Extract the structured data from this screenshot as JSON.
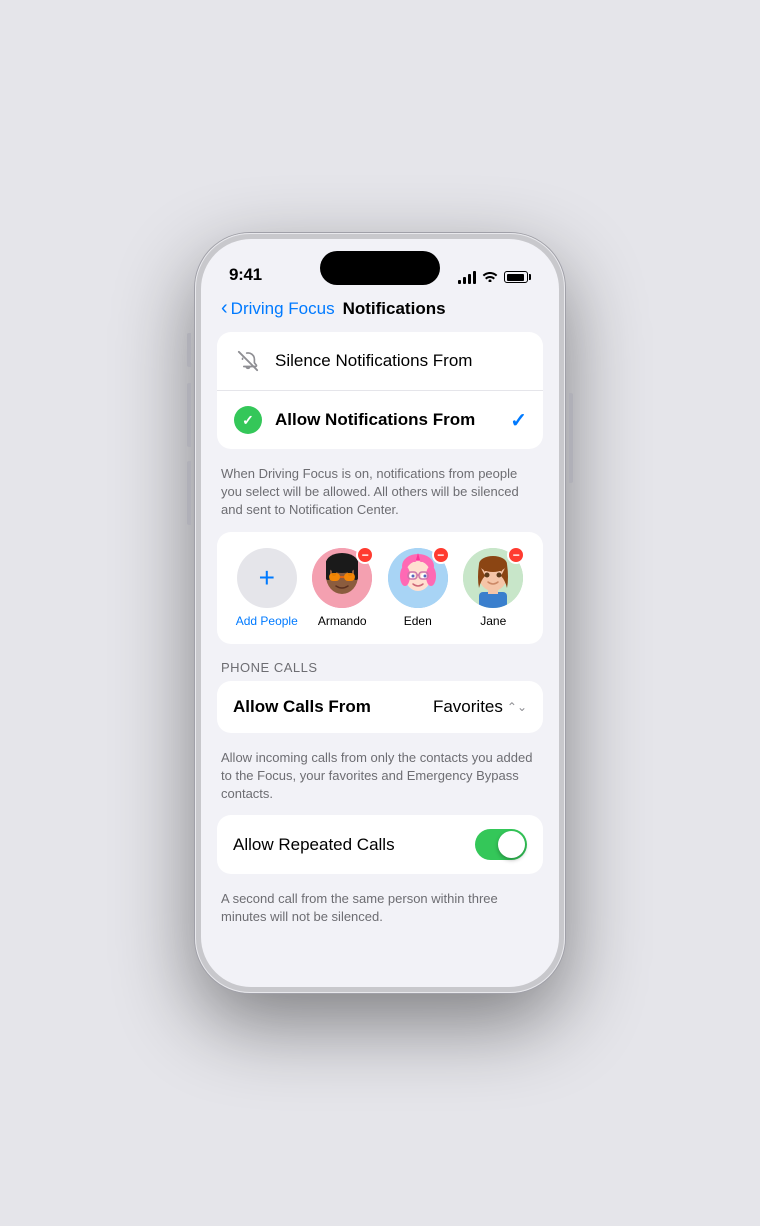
{
  "phone": {
    "time": "9:41",
    "dynamic_island": true
  },
  "nav": {
    "back_label": "Driving Focus",
    "title": "Notifications"
  },
  "silence_section": {
    "silence_row": {
      "label": "Silence Notifications From",
      "icon": "bell-muted"
    },
    "allow_row": {
      "label": "Allow Notifications From",
      "icon": "green-check",
      "selected": true
    },
    "description": "When Driving Focus is on, notifications from people you select will be allowed. All others will be silenced and sent to Notification Center."
  },
  "people": {
    "add_label": "Add People",
    "contacts": [
      {
        "name": "Armando",
        "emoji": "🧑🏿"
      },
      {
        "name": "Eden",
        "emoji": "👧"
      },
      {
        "name": "Jane",
        "emoji": "👩"
      }
    ]
  },
  "phone_calls": {
    "section_header": "PHONE CALLS",
    "allow_calls_label": "Allow Calls From",
    "allow_calls_value": "Favorites",
    "description": "Allow incoming calls from only the contacts you added to the Focus, your favorites and Emergency Bypass contacts.",
    "repeated_calls_label": "Allow Repeated Calls",
    "repeated_calls_on": true,
    "repeated_calls_description": "A second call from the same person within three minutes will not be silenced."
  }
}
